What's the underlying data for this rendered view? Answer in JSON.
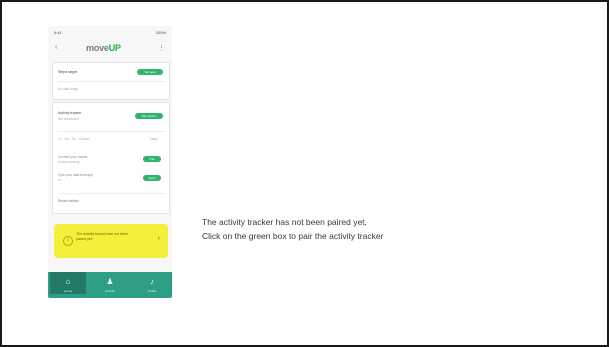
{
  "phone": {
    "status": {
      "time": "9:41",
      "battery": "100%"
    },
    "header": {
      "logo_prefix": "move",
      "logo_suffix": "UP"
    },
    "cards": {
      "card1": {
        "label": "Steps target",
        "action": "Set goal",
        "sub": "No data today"
      },
      "card2": {
        "label": "Activity tracker",
        "label2": "Not connected",
        "action": "Pair device",
        "tabs": "7d · 1m · 3m · Custom",
        "summary": "Today",
        "row1": "Connect your tracker",
        "row1b": "to start syncing",
        "row1_action": "Pair",
        "row2": "Sync your data from app",
        "row2b": "or",
        "row2_action": "Sync",
        "footer": "Recent activity"
      }
    },
    "toast": {
      "message": "The activity tracker has not been paired yet.",
      "arrow": "›"
    },
    "tabs": [
      {
        "label": "Home"
      },
      {
        "label": "Activity"
      },
      {
        "label": "Profile"
      }
    ]
  },
  "instructions": {
    "line1": "The activity tracker has not been paired yet,",
    "line2": "Click on the green box to pair the activity tracker"
  }
}
